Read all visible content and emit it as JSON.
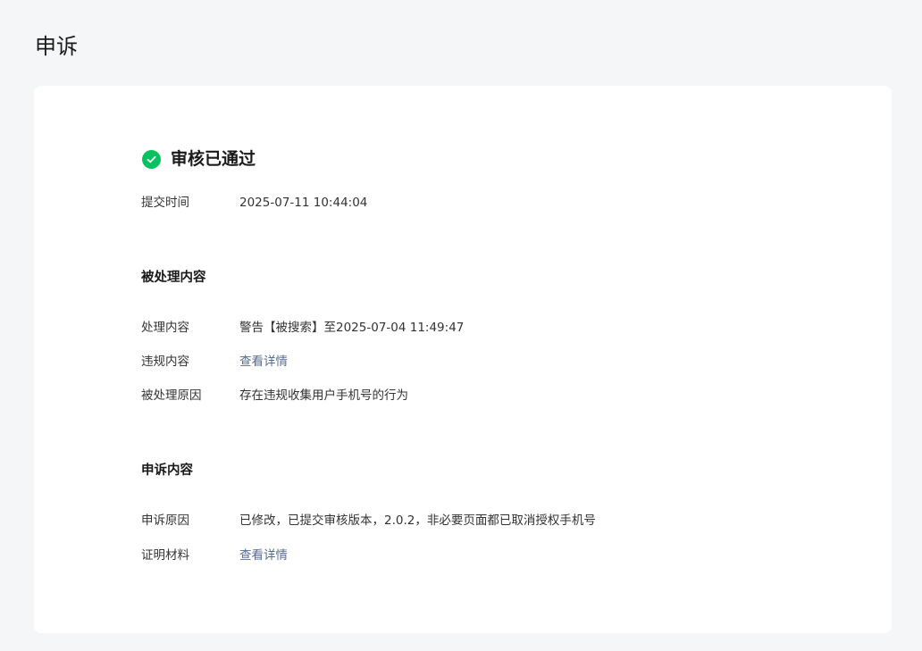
{
  "page": {
    "title": "申诉"
  },
  "status": {
    "text": "审核已通过",
    "icon": "check-circle-icon",
    "color": "#07c160"
  },
  "submit": {
    "label": "提交时间",
    "value": "2025-07-11 10:44:04"
  },
  "processed": {
    "title": "被处理内容",
    "rows": [
      {
        "label": "处理内容",
        "value": "警告【被搜索】至2025-07-04 11:49:47"
      },
      {
        "label": "违规内容",
        "value": "查看详情"
      },
      {
        "label": "被处理原因",
        "value": "存在违规收集用户手机号的行为"
      }
    ]
  },
  "appeal": {
    "title": "申诉内容",
    "rows": [
      {
        "label": "申诉原因",
        "value": "已修改，已提交审核版本，2.0.2，非必要页面都已取消授权手机号"
      },
      {
        "label": "证明材料",
        "value": "查看详情"
      }
    ]
  },
  "colors": {
    "link": "#576b95",
    "background": "#f5f6f8"
  }
}
